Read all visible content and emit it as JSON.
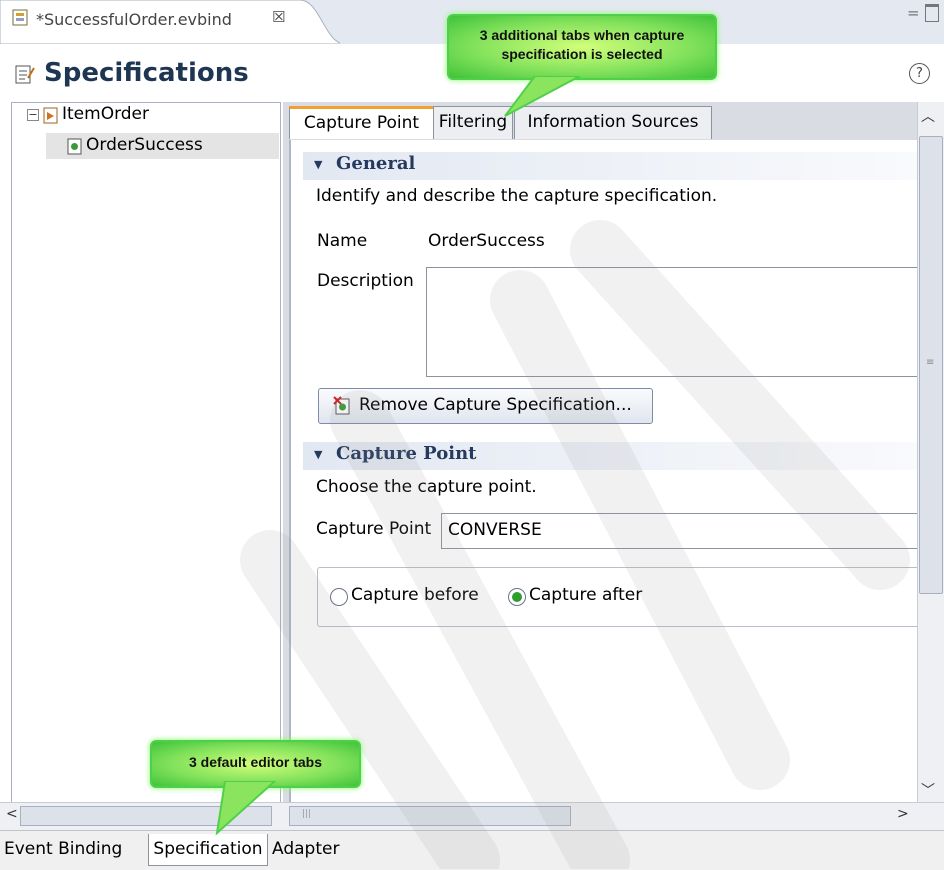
{
  "editor_tab": {
    "title": "*SuccessfulOrder.evbind",
    "close": "☒"
  },
  "window_controls": {
    "minimize": "="
  },
  "header": {
    "title": "Specifications",
    "help": "?"
  },
  "tree": {
    "expand_symbol": "−",
    "items": [
      {
        "label": "ItemOrder"
      },
      {
        "label": "OrderSuccess"
      }
    ]
  },
  "capture_tabs": [
    "Capture Point",
    "Filtering",
    "Information Sources"
  ],
  "general": {
    "title": "General",
    "description": "Identify and describe the capture specification.",
    "name_label": "Name",
    "name_value": "OrderSuccess",
    "description_label": "Description",
    "description_value": "",
    "remove_button": "Remove Capture Specification..."
  },
  "capture_point": {
    "title": "Capture Point",
    "description": "Choose the capture point.",
    "field_label": "Capture Point",
    "field_value": "CONVERSE",
    "options": [
      {
        "label": "Capture before",
        "selected": false
      },
      {
        "label": "Capture after",
        "selected": true
      }
    ]
  },
  "bottom_tabs": [
    "Event Binding",
    "Specification",
    "Adapter"
  ],
  "callouts": {
    "top": "3 additional tabs when capture specification is selected",
    "bottom": "3 default editor tabs"
  },
  "colors": {
    "accent_orange": "#f0a030",
    "callout_green": "#7fe05a",
    "section_title": "#253a5e"
  }
}
